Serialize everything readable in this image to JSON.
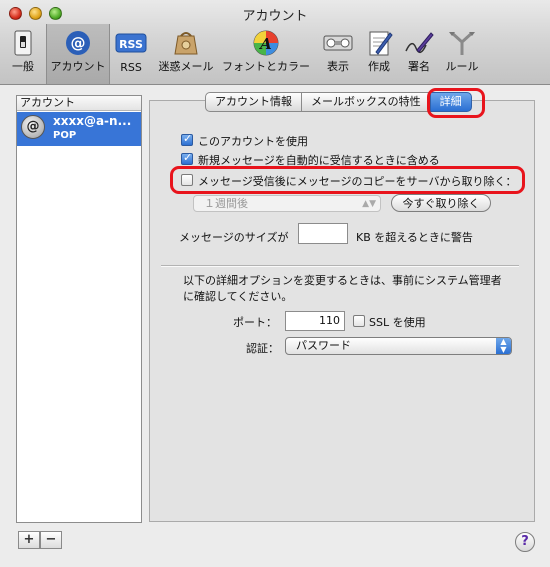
{
  "window": {
    "title": "アカウント"
  },
  "toolbar": {
    "items": [
      {
        "label": "一般",
        "icon": "switch-icon"
      },
      {
        "label": "アカウント",
        "icon": "at-sign-icon",
        "selected": true
      },
      {
        "label": "RSS",
        "icon": "rss-icon"
      },
      {
        "label": "迷惑メール",
        "icon": "junk-bag-icon"
      },
      {
        "label": "フォントとカラー",
        "icon": "font-color-icon"
      },
      {
        "label": "表示",
        "icon": "display-icon"
      },
      {
        "label": "作成",
        "icon": "compose-icon"
      },
      {
        "label": "署名",
        "icon": "signature-icon"
      },
      {
        "label": "ルール",
        "icon": "rules-icon"
      }
    ]
  },
  "accounts": {
    "header": "アカウント",
    "list": [
      {
        "name": "xxxx@a-n...",
        "type": "POP"
      }
    ],
    "add_label": "+",
    "remove_label": "−"
  },
  "tabs": [
    {
      "label": "アカウント情報"
    },
    {
      "label": "メールボックスの特性"
    },
    {
      "label": "詳細",
      "selected": true
    }
  ],
  "advanced": {
    "use_account": {
      "label": "このアカウントを使用",
      "checked": true
    },
    "auto_receive": {
      "label": "新規メッセージを自動的に受信するときに含める",
      "checked": true
    },
    "delete_copy": {
      "label": "メッセージ受信後にメッセージのコピーをサーバから取り除く：",
      "checked": false
    },
    "remove_after": {
      "value": "１週間後"
    },
    "remove_now_label": "今すぐ取り除く",
    "size_warn": {
      "label": "メッセージのサイズが",
      "value": "",
      "suffix": "KB を超えるときに警告"
    },
    "note": "以下の詳細オプションを変更するときは、事前にシステム管理者に確認してください。",
    "port": {
      "label": "ポート：",
      "value": "110"
    },
    "ssl": {
      "label": "SSL を使用",
      "checked": false
    },
    "auth": {
      "label": "認証：",
      "value": "パスワード"
    }
  },
  "help_label": "?",
  "colors": {
    "highlight": "#e8141c",
    "selection": "#3875d7",
    "accent": "#2a6fd3"
  }
}
